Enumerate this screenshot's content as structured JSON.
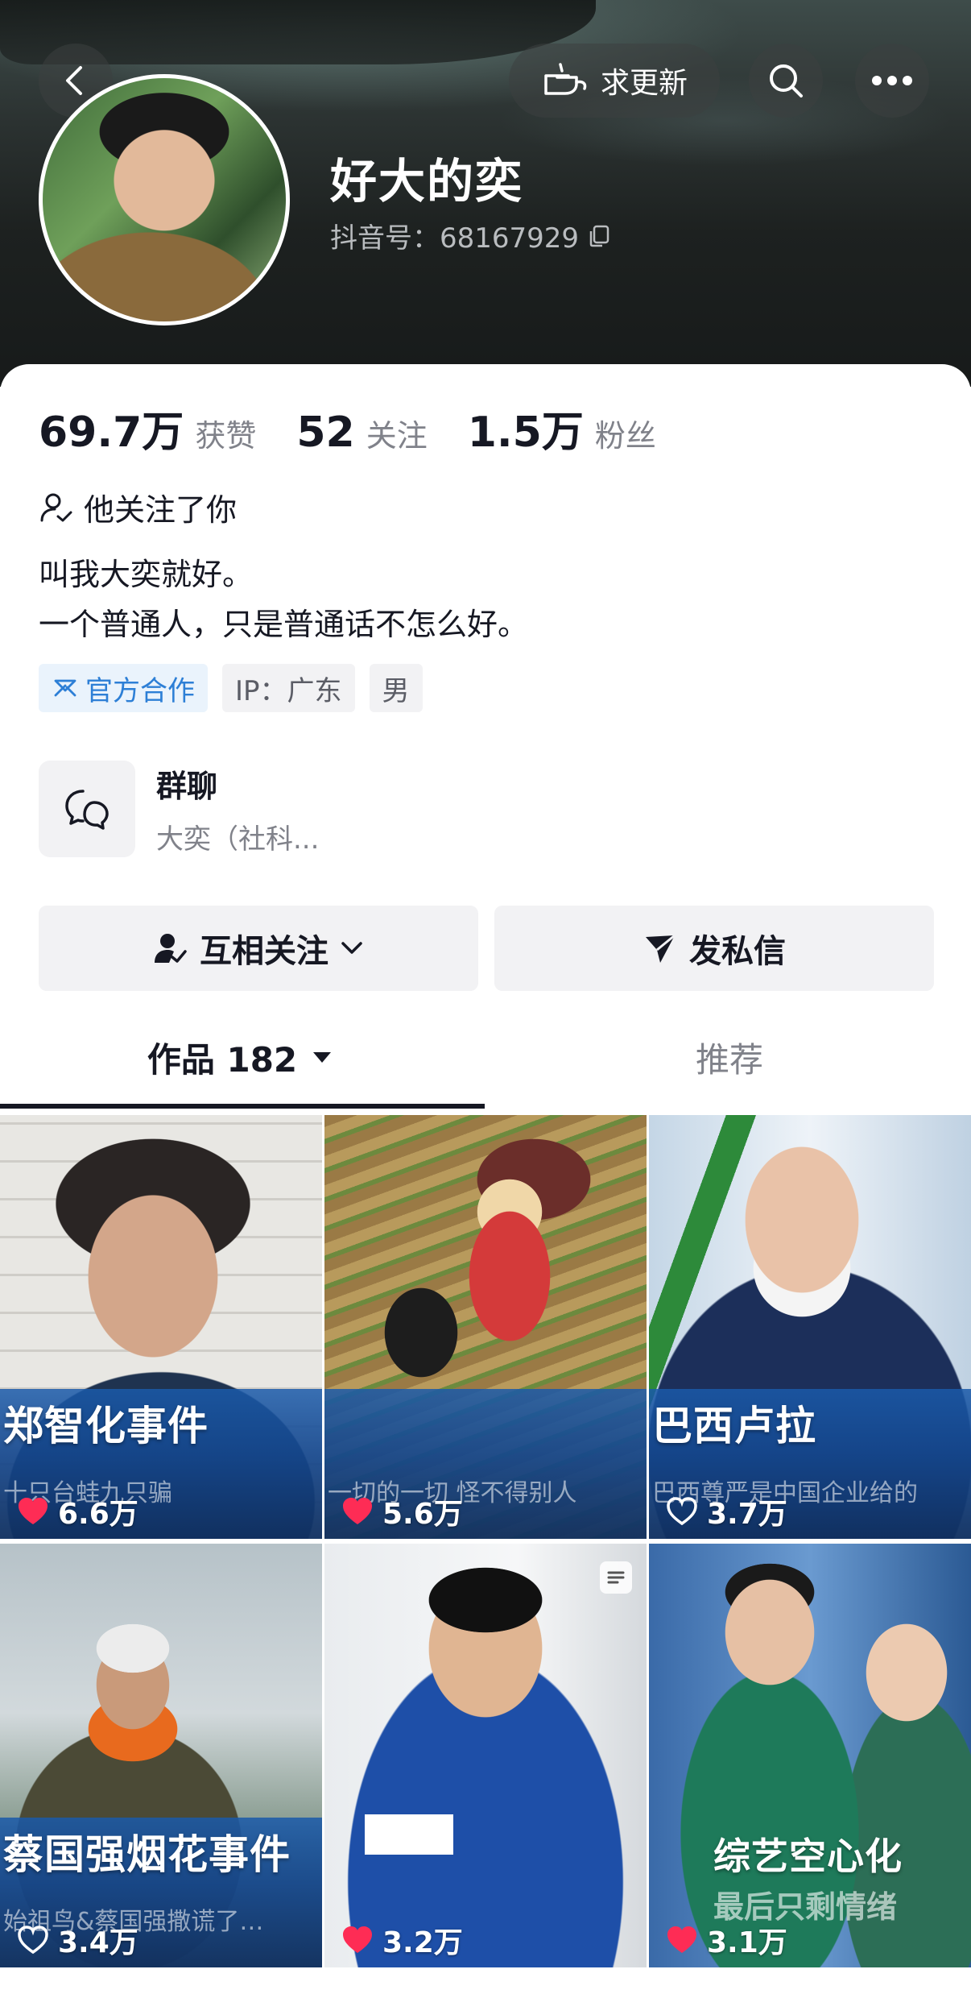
{
  "header": {
    "update_label": "求更新",
    "username": "好大的奕",
    "douyin_id": "抖音号：68167929"
  },
  "stats": [
    {
      "value": "69.7万",
      "label": "获赞"
    },
    {
      "value": "52",
      "label": "关注"
    },
    {
      "value": "1.5万",
      "label": "粉丝"
    }
  ],
  "follows_you": "他关注了你",
  "bio": [
    "叫我大奕就好。",
    "一个普通人，只是普通话不怎么好。"
  ],
  "tags": [
    "官方合作",
    "IP：广东",
    "男"
  ],
  "group_chat": {
    "title": "群聊",
    "subtitle": "大奕（社科..."
  },
  "actions": {
    "follow": "互相关注",
    "message": "发私信"
  },
  "tabs": {
    "works": "作品 182",
    "recommend": "推荐"
  },
  "videos": [
    {
      "caption": "郑智化事件",
      "subcaption": "十只台蛙九只骗",
      "likes": "6.6万",
      "liked": true
    },
    {
      "caption": "",
      "subcaption": "一切的一切 怪不得别人",
      "likes": "5.6万",
      "liked": true
    },
    {
      "caption": "巴西卢拉",
      "subcaption": "巴西尊严是中国企业给的",
      "likes": "3.7万",
      "liked": false
    },
    {
      "caption": "蔡国强烟花事件",
      "subcaption": "始祖鸟&蔡国强撒谎了…",
      "likes": "3.4万",
      "liked": false
    },
    {
      "caption": "",
      "subcaption": "",
      "likes": "3.2万",
      "liked": true
    },
    {
      "caption": "综艺空心化",
      "subcaption": "最后只剩情绪",
      "likes": "3.1万",
      "liked": true
    }
  ],
  "colors": {
    "like_red": "#fe2c55",
    "official_blue": "#2d7fd6",
    "text_dark": "#161823",
    "text_gray": "#80828a"
  }
}
